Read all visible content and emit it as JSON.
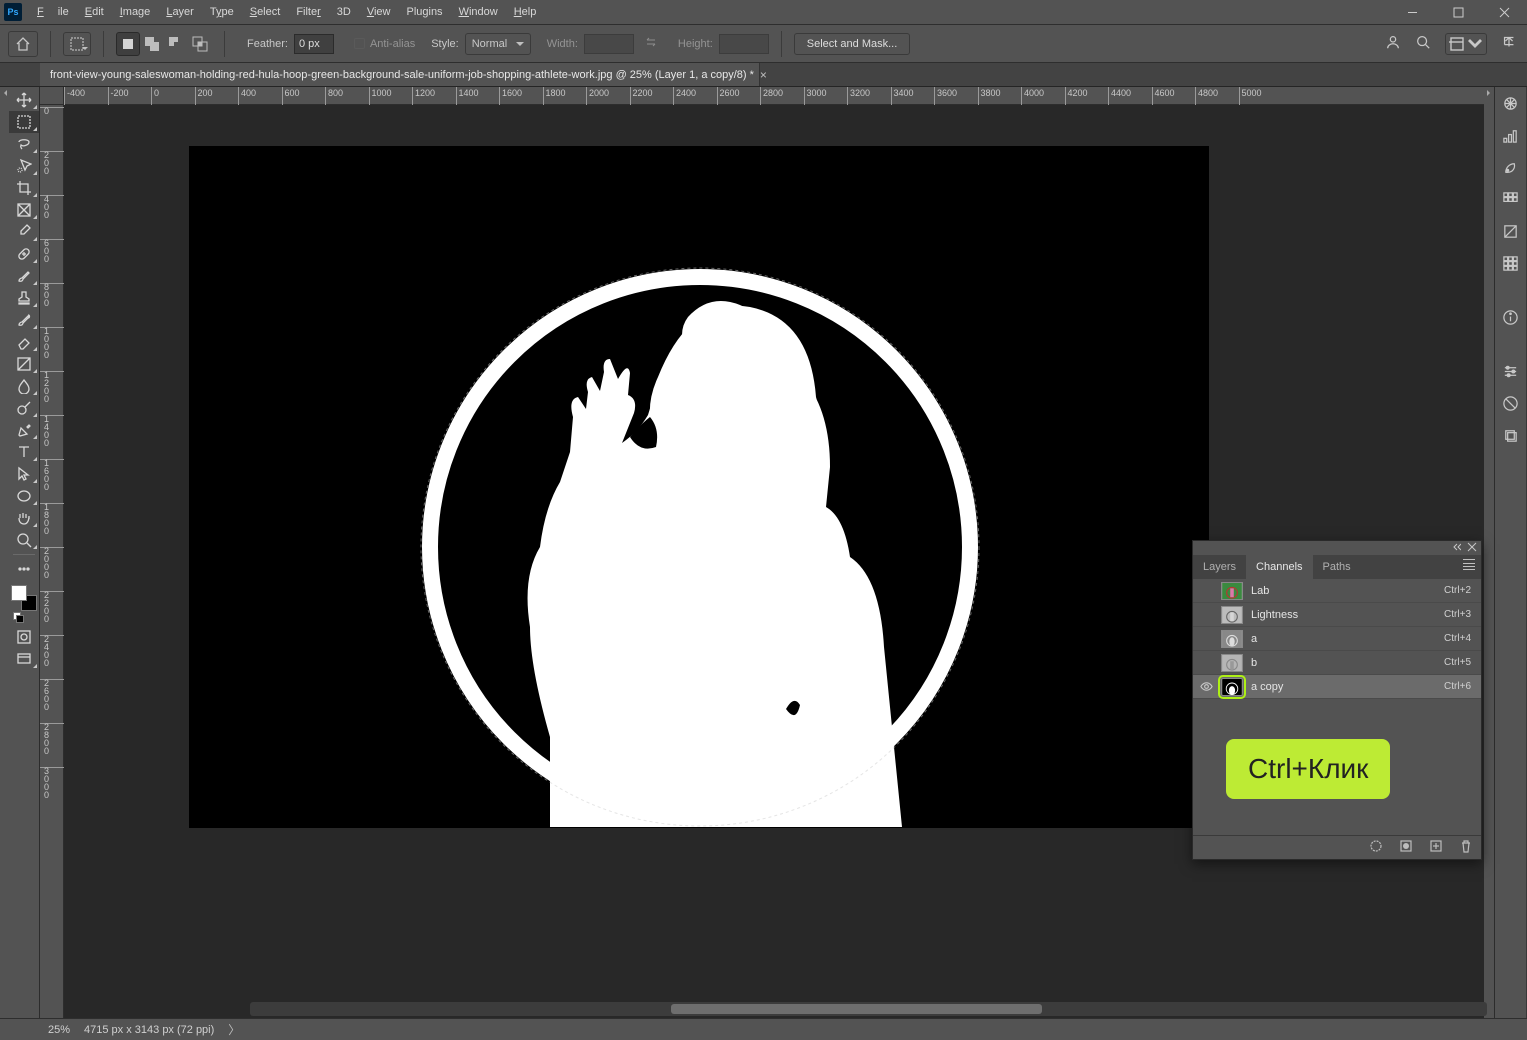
{
  "menu": {
    "file": "File",
    "edit": "Edit",
    "image": "Image",
    "layer": "Layer",
    "type": "Type",
    "select": "Select",
    "filter": "Filter",
    "d3": "3D",
    "view": "View",
    "plugins": "Plugins",
    "window": "Window",
    "help": "Help"
  },
  "options": {
    "feather_label": "Feather:",
    "feather_value": "0 px",
    "antialias_label": "Anti-alias",
    "style_label": "Style:",
    "style_value": "Normal",
    "width_label": "Width:",
    "width_value": "",
    "height_label": "Height:",
    "height_value": "",
    "mask_btn": "Select and Mask..."
  },
  "doc": {
    "title": "front-view-young-saleswoman-holding-red-hula-hoop-green-background-sale-uniform-job-shopping-athlete-work.jpg @ 25% (Layer 1, a copy/8) *"
  },
  "ruler_h": [
    "-400",
    "-200",
    "0",
    "200",
    "400",
    "600",
    "800",
    "1000",
    "1200",
    "1400",
    "1600",
    "1800",
    "2000",
    "2200",
    "2400",
    "2600",
    "2800",
    "3000",
    "3200",
    "3400",
    "3600",
    "3800",
    "4000",
    "4200",
    "4400",
    "4600",
    "4800",
    "5000"
  ],
  "ruler_v": [
    "0",
    "200",
    "400",
    "600",
    "800",
    "1000",
    "1200",
    "1400",
    "1600",
    "1800",
    "2000",
    "2200",
    "2400",
    "2600",
    "2800",
    "3000"
  ],
  "panel": {
    "tabs": {
      "layers": "Layers",
      "channels": "Channels",
      "paths": "Paths"
    },
    "channels": [
      {
        "name": "Lab",
        "key": "Ctrl+2"
      },
      {
        "name": "Lightness",
        "key": "Ctrl+3"
      },
      {
        "name": "a",
        "key": "Ctrl+4"
      },
      {
        "name": "b",
        "key": "Ctrl+5"
      },
      {
        "name": "a copy",
        "key": "Ctrl+6"
      }
    ],
    "callout": "Ctrl+Клик"
  },
  "status": {
    "zoom": "25%",
    "dims": "4715 px x 3143 px (72 ppi)"
  }
}
